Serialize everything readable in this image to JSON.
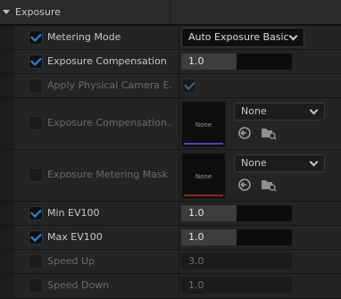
{
  "section": {
    "title": "Exposure"
  },
  "rows": [
    {
      "label": "Metering Mode",
      "checked": true,
      "enabled": true,
      "value": "Auto Exposure Basic"
    },
    {
      "label": "Exposure Compensation",
      "checked": true,
      "enabled": true,
      "value": "1.0",
      "fill_fraction": 0.5
    },
    {
      "label": "Apply Physical Camera E...",
      "checked": false,
      "enabled": false,
      "value_checked": true
    },
    {
      "label": "Exposure Compensation...",
      "checked": false,
      "enabled": false,
      "thumb_label": "None",
      "asset_value": "None",
      "accent": "#5a3fb8"
    },
    {
      "label": "Exposure Metering Mask",
      "checked": false,
      "enabled": false,
      "thumb_label": "None",
      "asset_value": "None",
      "accent": "#8a2a2a"
    },
    {
      "label": "Min EV100",
      "checked": true,
      "enabled": true,
      "value": "1.0",
      "fill_fraction": 0.5
    },
    {
      "label": "Max EV100",
      "checked": true,
      "enabled": true,
      "value": "1.0",
      "fill_fraction": 0.5
    },
    {
      "label": "Speed Up",
      "checked": false,
      "enabled": false,
      "value": "3.0"
    },
    {
      "label": "Speed Down",
      "checked": false,
      "enabled": false,
      "value": "1.0"
    }
  ],
  "icons": {
    "collapse": "triangle-down-icon",
    "reset": "use-selected-asset-icon",
    "browse": "browse-folder-icon",
    "dropdown": "chevron-down-icon"
  }
}
